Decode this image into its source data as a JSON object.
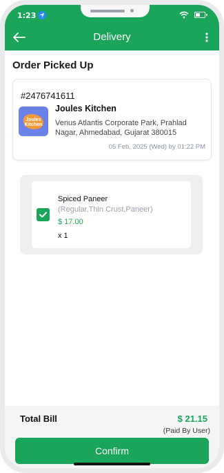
{
  "status_bar": {
    "time": "1:23"
  },
  "header": {
    "title": "Delivery"
  },
  "order": {
    "section_title": "Order Picked Up",
    "id": "#2476741611",
    "restaurant": {
      "name": "Joules Kitchen",
      "logo_text_line1": "Joules",
      "logo_text_line2": "Kitchen",
      "address": "Venus Atlantis Corporate Park, Prahlad Nagar, Ahmedabad, Gujarat 380015"
    },
    "date": "05 Feb, 2025 (Wed) by 01:22 PM"
  },
  "items": [
    {
      "name": "Spiced Paneer",
      "options": "(Regular,Thin Crust,Paneer)",
      "price": "$ 17.00",
      "quantity": "x 1",
      "checked": true
    }
  ],
  "bill": {
    "label": "Total Bill",
    "amount": "$ 21.15",
    "note": "(Paid By User)"
  },
  "actions": {
    "confirm_label": "Confirm"
  },
  "colors": {
    "primary": "#1aa55a",
    "location_icon": "#2b8af7",
    "restaurant_logo_bg": "#6b83e8"
  },
  "icons": [
    "location-arrow-icon",
    "wifi-icon",
    "battery-icon",
    "back-arrow-icon",
    "more-vertical-icon",
    "checkbox-checked-icon"
  ]
}
